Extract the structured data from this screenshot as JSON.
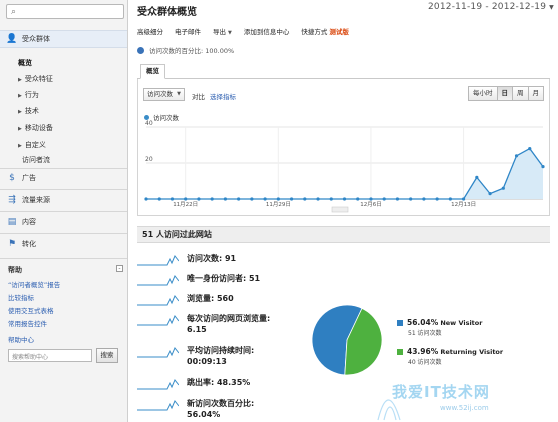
{
  "sidebar": {
    "sections": [
      {
        "label": "受众群体",
        "icon": "people-icon"
      },
      {
        "label": "广告",
        "icon": "dollar-icon"
      },
      {
        "label": "流量来源",
        "icon": "traffic-icon"
      },
      {
        "label": "内容",
        "icon": "content-icon"
      },
      {
        "label": "转化",
        "icon": "flag-icon"
      }
    ],
    "audience_items": [
      "概览",
      "受众特征",
      "行为",
      "技术",
      "移动设备",
      "自定义",
      "访问者流"
    ],
    "help": {
      "title": "帮助",
      "collapse": "-",
      "links": [
        "“访问者概览”报告",
        "比较指标",
        "使用交互式表格",
        "常用报告控件"
      ],
      "center_title": "帮助中心",
      "search_placeholder": "搜索帮助中心",
      "search_button": "搜索"
    }
  },
  "header": {
    "title": "受众群体概览",
    "date_range": "2012-11-19 - 2012-12-19"
  },
  "toolbar": {
    "items": [
      "高级细分",
      "电子邮件",
      "导出",
      "添加到信息中心",
      "快捷方式"
    ],
    "beta": "测试版"
  },
  "segment": {
    "label": "访问次数的百分比: 100.00%"
  },
  "tabs": {
    "overview": "概览"
  },
  "chart_controls": {
    "metric": "访问次数",
    "vs": "对比",
    "pick": "选择指标",
    "granularity": [
      "每小时",
      "日",
      "周",
      "月"
    ],
    "selected": "日"
  },
  "chart_data": {
    "type": "area",
    "legend": "访问次数",
    "ylim": [
      0,
      40
    ],
    "yticks": [
      20,
      40
    ],
    "xticks": [
      "11月22日",
      "11月29日",
      "12月6日",
      "12月13日"
    ],
    "x": [
      "11-19",
      "11-20",
      "11-21",
      "11-22",
      "11-23",
      "11-24",
      "11-25",
      "11-26",
      "11-27",
      "11-28",
      "11-29",
      "11-30",
      "12-01",
      "12-02",
      "12-03",
      "12-04",
      "12-05",
      "12-06",
      "12-07",
      "12-08",
      "12-09",
      "12-10",
      "12-11",
      "12-12",
      "12-13",
      "12-14",
      "12-15",
      "12-16",
      "12-17",
      "12-18",
      "12-19"
    ],
    "values": [
      0,
      0,
      0,
      0,
      0,
      0,
      0,
      0,
      0,
      0,
      0,
      0,
      0,
      0,
      0,
      0,
      0,
      0,
      0,
      0,
      0,
      0,
      0,
      0,
      0,
      12,
      3,
      6,
      24,
      28,
      18
    ]
  },
  "visitors": {
    "title": "51 人访问过此网站",
    "metrics": [
      {
        "label": "访问次数: 91"
      },
      {
        "label": "唯一身份访问者: 51"
      },
      {
        "label": "浏览量: 560"
      },
      {
        "label": "每次访问的网页浏览量:",
        "value": "6.15"
      },
      {
        "label": "平均访问持续时间:",
        "value": "00:09:13"
      },
      {
        "label": "跳出率: 48.35%"
      },
      {
        "label": "新访问次数百分比:",
        "value": "56.04%"
      }
    ],
    "pie": {
      "slices": [
        {
          "name": "New Visitor",
          "pct": "56.04%",
          "visits": "51 访问次数",
          "color": "#2f7fc1",
          "share": 0.5604
        },
        {
          "name": "Returning Visitor",
          "pct": "43.96%",
          "visits": "40 访问次数",
          "color": "#4eb13f",
          "share": 0.4396
        }
      ]
    }
  },
  "watermark": {
    "text": "我爱IT技术网",
    "url": "www.52ij.com"
  }
}
